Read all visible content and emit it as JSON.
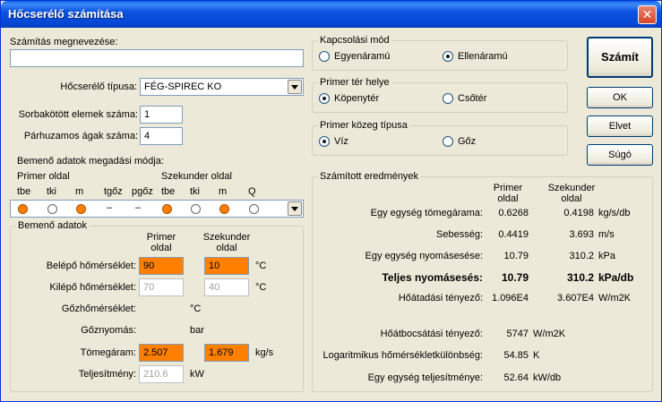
{
  "window": {
    "title": "Hőcserélő számítása",
    "close": "✕"
  },
  "left": {
    "calc_name_label": "Számítás megnevezése:",
    "calc_name_value": "",
    "type_label": "Hőcserélő típusa:",
    "type_value": "FÉG-SPIREC KO",
    "series_label": "Sorbakötött elemek száma:",
    "series_value": "1",
    "parallel_label": "Párhuzamos ágak száma:",
    "parallel_value": "4",
    "mode_label": "Bemenő adatok megadási módja:",
    "primer_side": "Primer oldal",
    "secunder_side": "Szekunder oldal",
    "cols": [
      "tbe",
      "tki",
      "m",
      "tgőz",
      "pgőz",
      "tbe",
      "tki",
      "m",
      "Q"
    ],
    "col_states": [
      "on",
      "off",
      "on",
      "dash",
      "dash",
      "on",
      "off",
      "on",
      "off"
    ],
    "dash": "–"
  },
  "input": {
    "title": "Bemenő adatok",
    "primer_header": "Primer\noldal",
    "primer_h1": "Primer",
    "primer_h2": "oldal",
    "sek_h1": "Szekunder",
    "sek_h2": "oldal",
    "in_temp_label": "Belépő hőmérséklet:",
    "in_temp_primer": "90",
    "in_temp_sek": "10",
    "out_temp_label": "Kilépő hőmérséklet:",
    "out_temp_primer": "70",
    "out_temp_sek": "40",
    "steam_temp_label": "Gőzhőmérséklet:",
    "steam_press_label": "Gőznyomás:",
    "mass_label": "Tömegáram:",
    "mass_primer": "2.507",
    "mass_sek": "1.679",
    "power_label": "Teljesítmény:",
    "power_value": "210.6",
    "unit_c": "°C",
    "unit_bar": "bar",
    "unit_kgs": "kg/s",
    "unit_kw": "kW"
  },
  "switch_mode": {
    "title": "Kapcsolási mód",
    "opt1": "Egyenáramú",
    "opt2": "Ellenáramú"
  },
  "primer_space": {
    "title": "Primer tér helye",
    "opt1": "Köpenytér",
    "opt2": "Csőtér"
  },
  "primer_medium": {
    "title": "Primer közeg típusa",
    "opt1": "Víz",
    "opt2": "Gőz"
  },
  "buttons": {
    "calc": "Számít",
    "ok": "OK",
    "cancel": "Elvet",
    "help": "Súgó"
  },
  "results": {
    "title": "Számított eredmények",
    "primer_h1": "Primer",
    "primer_h2": "oldal",
    "sek_h1": "Szekunder",
    "sek_h2": "oldal",
    "rows": [
      {
        "label": "Egy egység tömegárama:",
        "p": "0.6268",
        "s": "0.4198",
        "u": "kg/s/db"
      },
      {
        "label": "Sebesség:",
        "p": "0.4419",
        "s": "3.693",
        "u": "m/s"
      },
      {
        "label": "Egy egység nyomásesése:",
        "p": "10.79",
        "s": "310.2",
        "u": "kPa"
      },
      {
        "label": "Teljes nyomásesés:",
        "p": "10.79",
        "s": "310.2",
        "u": "kPa/db"
      },
      {
        "label": "Hőátadási tényező:",
        "p": "1.096E4",
        "s": "3.607E4",
        "u": "W/m2K"
      }
    ],
    "singles": [
      {
        "label": "Hőátbocsátási tényező:",
        "v": "5747",
        "u": "W/m2K"
      },
      {
        "label": "Logaritmikus hőmérsékletkülönbség:",
        "v": "54.85",
        "u": "K"
      },
      {
        "label": "Egy egység teljesítménye:",
        "v": "52.64",
        "u": "kW/db"
      }
    ]
  }
}
